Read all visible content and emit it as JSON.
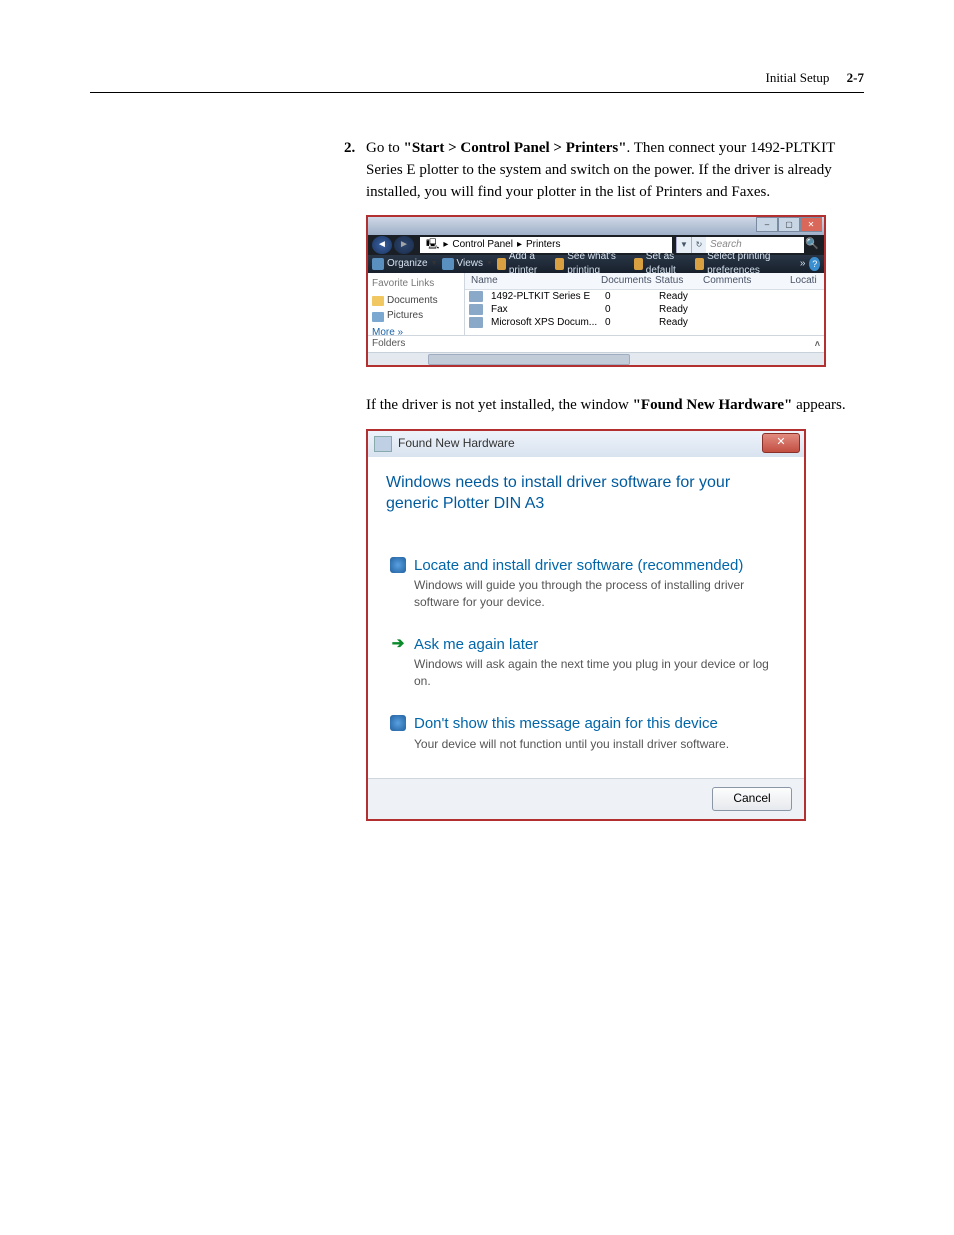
{
  "header": {
    "section": "Initial Setup",
    "page": "2-7"
  },
  "step": {
    "num": "2.",
    "pre": "Go to ",
    "path": "\"Start > Control Panel > Printers\"",
    "post": ". Then connect your 1492-PLTKIT Series E  plotter to the system and switch on the power. If the driver is already installed, you will find your plotter in the list of Printers and Faxes."
  },
  "printers_window": {
    "breadcrumb": [
      "Control Panel",
      "Printers"
    ],
    "search_placeholder": "Search",
    "toolbar": {
      "organize": "Organize",
      "views": "Views",
      "add": "Add a printer",
      "see": "See what's printing",
      "setdef": "Set as default",
      "pref": "Select printing preferences",
      "more": "»"
    },
    "sidebar": {
      "fav_header": "Favorite Links",
      "documents": "Documents",
      "pictures": "Pictures",
      "more": "More »",
      "folders": "Folders"
    },
    "columns": {
      "name": "Name",
      "documents": "Documents",
      "status": "Status",
      "comments": "Comments",
      "location": "Locati"
    },
    "rows": [
      {
        "name": "1492-PLTKIT Series E",
        "docs": "0",
        "status": "Ready",
        "comments": ""
      },
      {
        "name": "Fax",
        "docs": "0",
        "status": "Ready",
        "comments": ""
      },
      {
        "name": "Microsoft XPS Docum...",
        "docs": "0",
        "status": "Ready",
        "comments": ""
      }
    ]
  },
  "mid_para": {
    "pre": "If the driver is not yet installed, the window ",
    "bold": "\"Found New Hardware\"",
    "post": " appears."
  },
  "fnh": {
    "title": "Found New Hardware",
    "message": "Windows needs to install driver software for your generic Plotter DIN A3",
    "opts": [
      {
        "title": "Locate and install driver software (recommended)",
        "desc": "Windows will guide you through the process of installing driver software for your device.",
        "icon": "shield"
      },
      {
        "title": "Ask me again later",
        "desc": "Windows will ask again the next time you plug in your device or log on.",
        "icon": "arrow"
      },
      {
        "title": "Don't show this message again for this device",
        "desc": "Your device will not function until you install driver software.",
        "icon": "shield"
      }
    ],
    "cancel": "Cancel"
  }
}
